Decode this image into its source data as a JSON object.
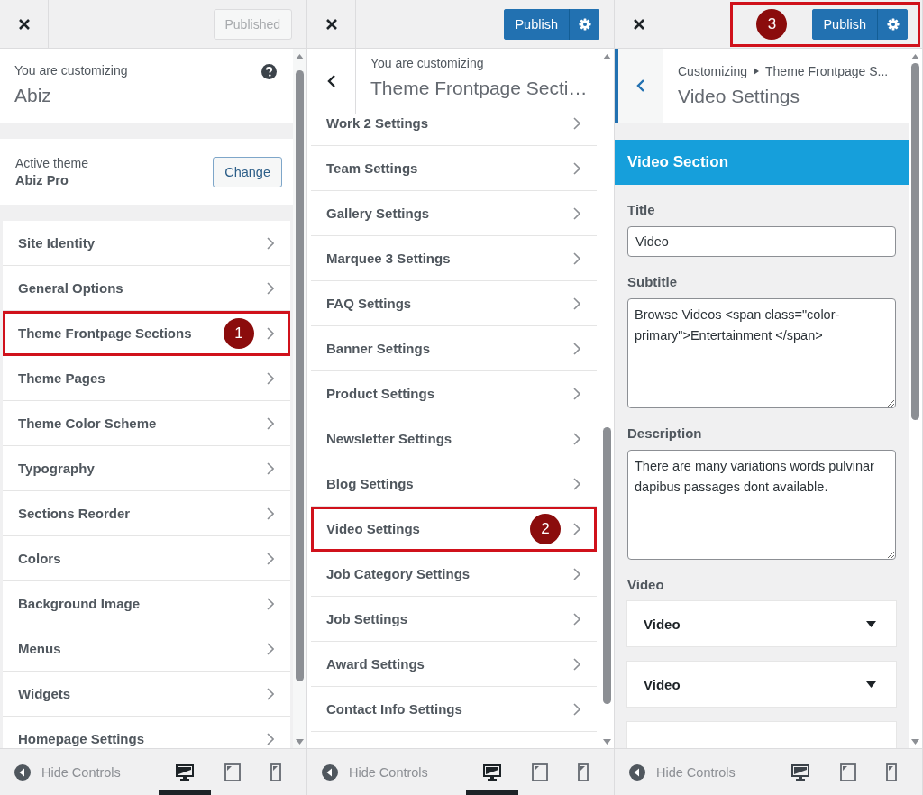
{
  "panels": [
    {
      "kind": "root",
      "header": {
        "publish": {
          "label": "Published",
          "disabled": true,
          "highlighted": false
        }
      },
      "info": {
        "label": "You are customizing",
        "title": "Abiz"
      },
      "theme": {
        "label": "Active theme",
        "name": "Abiz Pro",
        "button": "Change"
      },
      "items": [
        {
          "label": "Site Identity",
          "highlighted": false
        },
        {
          "label": "General Options",
          "highlighted": false
        },
        {
          "label": "Theme Frontpage Sections",
          "highlighted": true,
          "callout": "1"
        },
        {
          "label": "Theme Pages",
          "highlighted": false
        },
        {
          "label": "Theme Color Scheme",
          "highlighted": false
        },
        {
          "label": "Typography",
          "highlighted": false
        },
        {
          "label": "Sections Reorder",
          "highlighted": false
        },
        {
          "label": "Colors",
          "highlighted": false
        },
        {
          "label": "Background Image",
          "highlighted": false
        },
        {
          "label": "Menus",
          "highlighted": false
        },
        {
          "label": "Widgets",
          "highlighted": false
        },
        {
          "label": "Homepage Settings",
          "highlighted": false
        }
      ],
      "footer": {
        "label": "Hide Controls",
        "devices": [
          {
            "kind": "desktop",
            "selected": true
          },
          {
            "kind": "tablet",
            "selected": false
          },
          {
            "kind": "mobile",
            "selected": false
          }
        ]
      }
    },
    {
      "kind": "section",
      "header": {
        "publish": {
          "label": "Publish",
          "disabled": false,
          "highlighted": false
        }
      },
      "back": {
        "label": "You are customizing",
        "title": "Theme Frontpage Secti…"
      },
      "items": [
        {
          "label": "Work 2 Settings",
          "highlighted": false
        },
        {
          "label": "Team Settings",
          "highlighted": false
        },
        {
          "label": "Gallery Settings",
          "highlighted": false
        },
        {
          "label": "Marquee 3 Settings",
          "highlighted": false
        },
        {
          "label": "FAQ Settings",
          "highlighted": false
        },
        {
          "label": "Banner Settings",
          "highlighted": false
        },
        {
          "label": "Product Settings",
          "highlighted": false
        },
        {
          "label": "Newsletter Settings",
          "highlighted": false
        },
        {
          "label": "Blog Settings",
          "highlighted": false
        },
        {
          "label": "Video Settings",
          "highlighted": true,
          "callout": "2"
        },
        {
          "label": "Job Category Settings",
          "highlighted": false
        },
        {
          "label": "Job Settings",
          "highlighted": false
        },
        {
          "label": "Award Settings",
          "highlighted": false
        },
        {
          "label": "Contact Info Settings",
          "highlighted": false
        }
      ],
      "footer": {
        "label": "Hide Controls",
        "devices": [
          {
            "kind": "desktop",
            "selected": true
          },
          {
            "kind": "tablet",
            "selected": false
          },
          {
            "kind": "mobile",
            "selected": false
          }
        ]
      }
    },
    {
      "kind": "form",
      "header": {
        "publish": {
          "label": "Publish",
          "disabled": false,
          "highlighted": true,
          "callout": "3"
        }
      },
      "back": {
        "breadcrumb": [
          "Customizing",
          "Theme Frontpage S..."
        ],
        "title": "Video Settings"
      },
      "section_title": "Video Section",
      "fields": [
        {
          "kind": "text",
          "label": "Title",
          "value": "Video"
        },
        {
          "kind": "textarea",
          "label": "Subtitle",
          "value": "Browse Videos <span class=\"color-primary\">Entertainment </span>"
        },
        {
          "kind": "textarea",
          "label": "Description",
          "value": "There are many variations words pulvinar dapibus passages dont available."
        },
        {
          "kind": "repeater",
          "label": "Video",
          "items": [
            "Video",
            "Video"
          ]
        }
      ],
      "footer": {
        "label": "Hide Controls",
        "devices": [
          {
            "kind": "desktop",
            "selected": false
          },
          {
            "kind": "tablet",
            "selected": false
          },
          {
            "kind": "mobile",
            "selected": false
          }
        ]
      }
    }
  ]
}
